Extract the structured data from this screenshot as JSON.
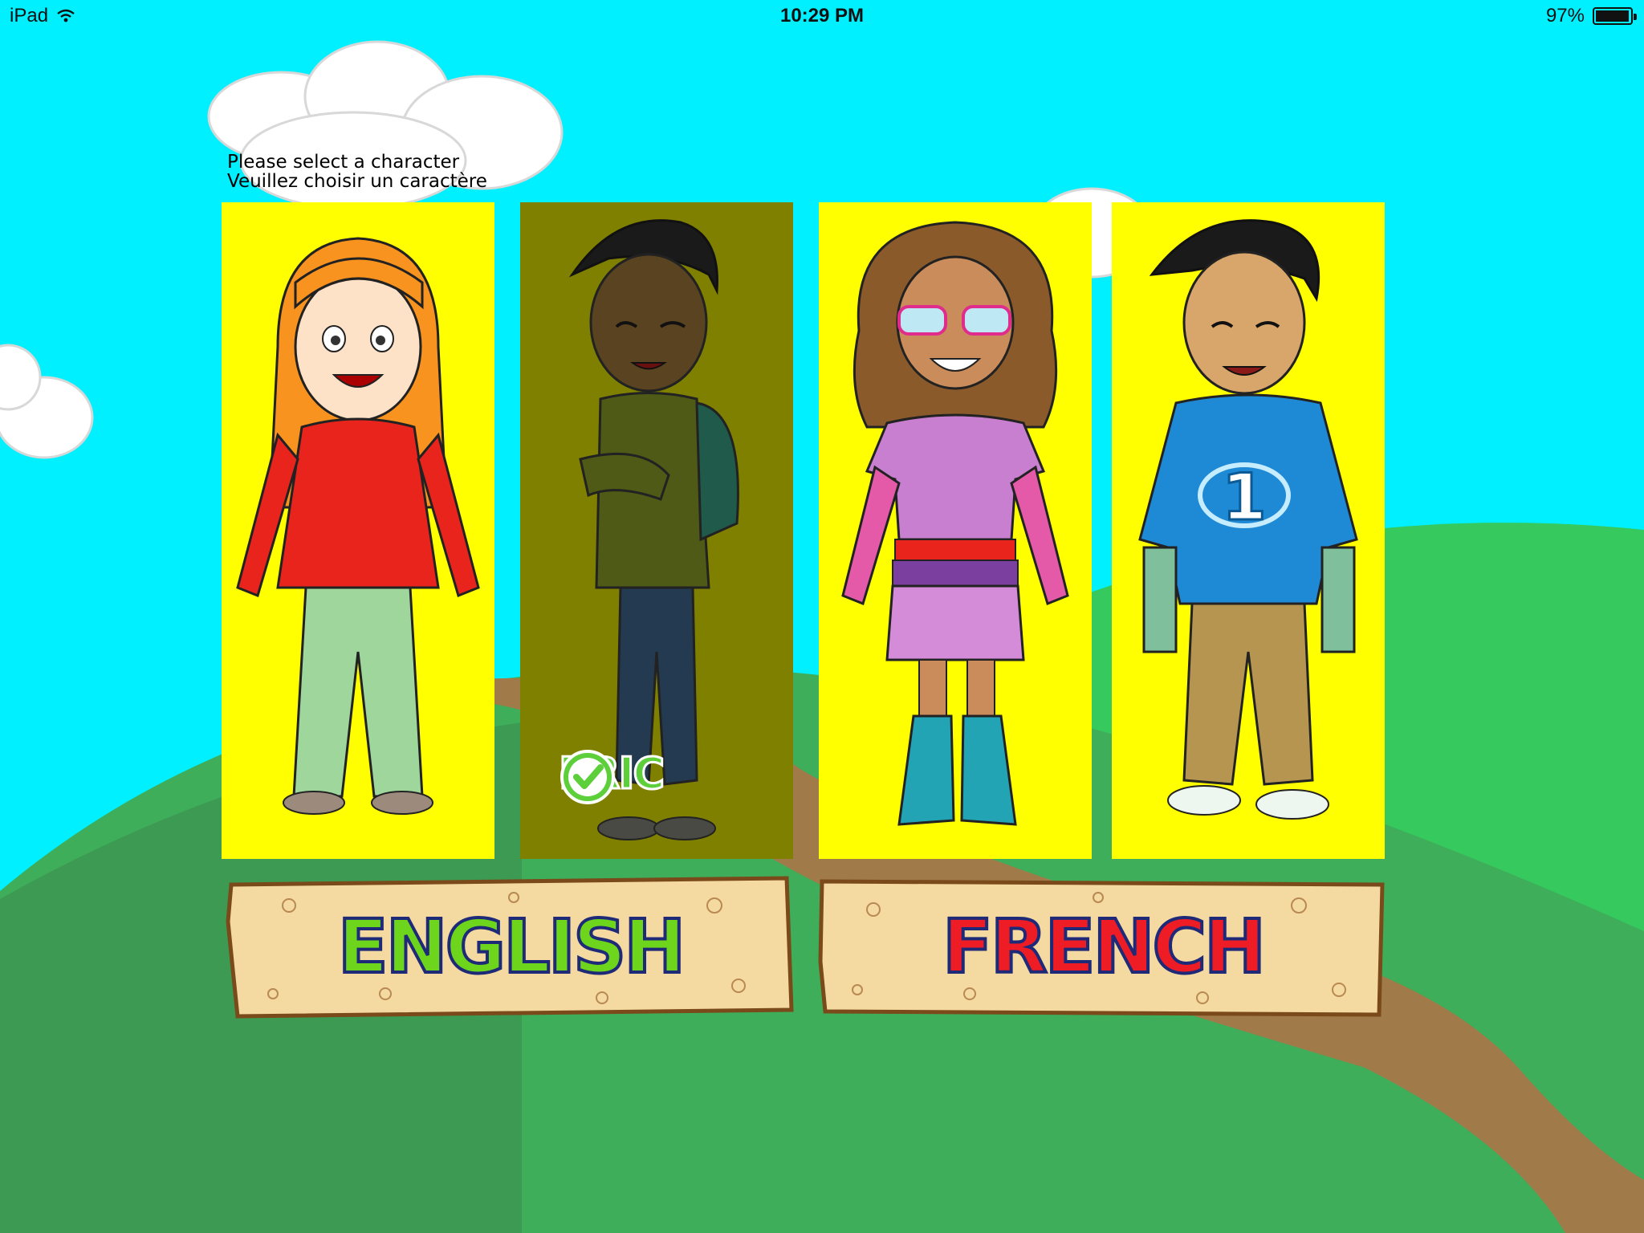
{
  "status_bar": {
    "device": "iPad",
    "time": "10:29 PM",
    "battery": "97%",
    "battery_level": 0.97
  },
  "instructions": {
    "line1": "Please select a character",
    "line2": "Veuillez choisir un caractère"
  },
  "characters": [
    {
      "id": "girl-redhead",
      "selected": false
    },
    {
      "id": "eric",
      "name": "ERIC",
      "selected": true
    },
    {
      "id": "girl-curly",
      "selected": false
    },
    {
      "id": "boy-blue-shirt",
      "selected": false
    }
  ],
  "language_buttons": {
    "english": "ENGLISH",
    "french": "FRENCH"
  },
  "colors": {
    "sky": "#00f0ff",
    "card_bg": "#ffff00",
    "card_selected_bg": "#808000",
    "grass": "#3cb85a",
    "path": "#a07a48",
    "english_text": "#6dd61c",
    "french_text": "#ee1c24",
    "text_outline": "#1e2a78",
    "plank": "#f4d9a0"
  }
}
